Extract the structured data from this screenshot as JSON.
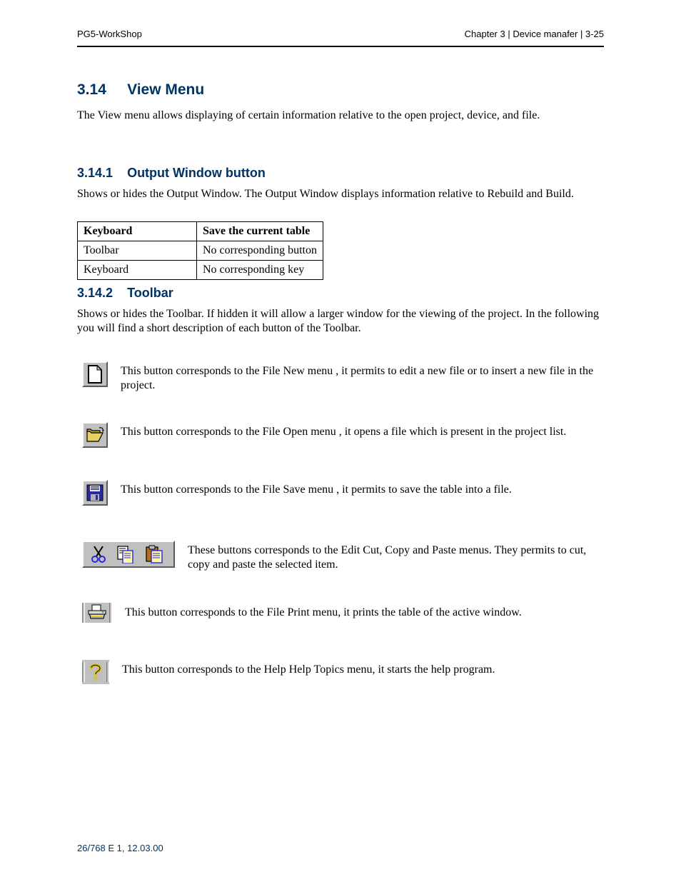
{
  "header": {
    "left": "PG5-WorkShop",
    "right": "Chapter 3 | Device manafer | 3-25"
  },
  "section": {
    "number": "3.14",
    "title": "View Menu"
  },
  "section_intro": "The View menu allows displaying of certain information relative to the open project, device, and file.",
  "subsection": {
    "number": "3.14.1",
    "title": "Output Window button"
  },
  "subsection_para": "Shows or hides the Output Window. The Output Window displays information relative to Rebuild and Build.",
  "table": {
    "headers": [
      "Keyboard",
      "Save the current table"
    ],
    "rows": [
      [
        "Toolbar",
        "No corresponding button"
      ],
      [
        "Keyboard",
        "No corresponding key"
      ]
    ]
  },
  "item_label": "3.14.2",
  "item_title": "Toolbar",
  "item_para": "Shows or hides the Toolbar. If hidden it will allow a larger window for the viewing of the project. In the following you will find a short description of each button of the Toolbar.",
  "items": [
    {
      "label": "This button corresponds to the File    New menu     , it permits to edit a new file or to insert a new file in the project."
    },
    {
      "label": "This button corresponds to the File    Open menu     , it opens a file which is present in the project list."
    },
    {
      "label": "This button corresponds to the File    Save menu     , it permits to save the table into a file."
    },
    {
      "label": "These buttons corresponds to the Edit    Cut, Copy and Paste menus. They permits to cut, copy and paste the selected item."
    },
    {
      "label": "This button corresponds to the File    Print menu, it prints the table of the active window."
    },
    {
      "label": "This button corresponds to the Help    Help Topics menu, it starts the help program."
    }
  ],
  "footer": "26/768    E 1, 12.03.00"
}
